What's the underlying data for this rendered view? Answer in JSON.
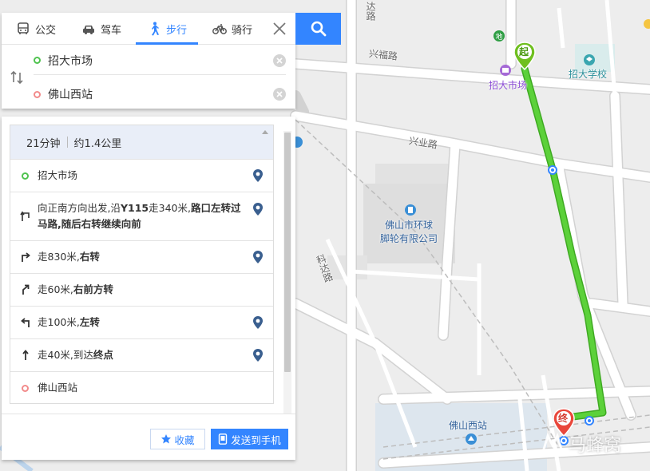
{
  "map": {
    "roads": {
      "xingfu": "兴福路",
      "xingye": "兴业路",
      "keda": "科达路",
      "top_road_fragment": "达路"
    },
    "pois": {
      "start_market": "招大市场",
      "school": "招大学校",
      "company_line1": "佛山市环球",
      "company_line2": "脚轮有限公司",
      "station": "佛山西站"
    },
    "markers": {
      "start": "起",
      "end": "终"
    },
    "colors": {
      "route": "#5cd13a",
      "route_dark": "#3faa22",
      "start_pin": "#6fbf1f",
      "end_pin": "#e9473b",
      "accent": "#3385ff"
    }
  },
  "panel": {
    "tabs": [
      {
        "label": "公交",
        "icon": "bus-icon"
      },
      {
        "label": "驾车",
        "icon": "car-icon"
      },
      {
        "label": "步行",
        "icon": "walk-icon"
      },
      {
        "label": "骑行",
        "icon": "bike-icon"
      }
    ],
    "active_tab": "步行",
    "start_value": "招大市场",
    "end_value": "佛山西站"
  },
  "result": {
    "duration": "21分钟",
    "distance": "约1.4公里",
    "steps": [
      {
        "type": "start",
        "text": "招大市场"
      },
      {
        "type": "left-up",
        "pre": "向正南方向出发,沿",
        "b1": "Y115",
        "mid": "走340米,",
        "b2": "路口左转过马路,随后右转继续向前"
      },
      {
        "type": "right",
        "pre": "走830米,",
        "b1": "右转"
      },
      {
        "type": "bear-right",
        "pre": "走60米,",
        "b1": "右前方转"
      },
      {
        "type": "left",
        "pre": "走100米,",
        "b1": "左转"
      },
      {
        "type": "straight",
        "pre": "走40米,到达",
        "b1": "终点"
      },
      {
        "type": "end",
        "text": "佛山西站"
      }
    ],
    "favorite_label": "收藏",
    "send_label": "发送到手机"
  },
  "watermark": "马蜂窝"
}
